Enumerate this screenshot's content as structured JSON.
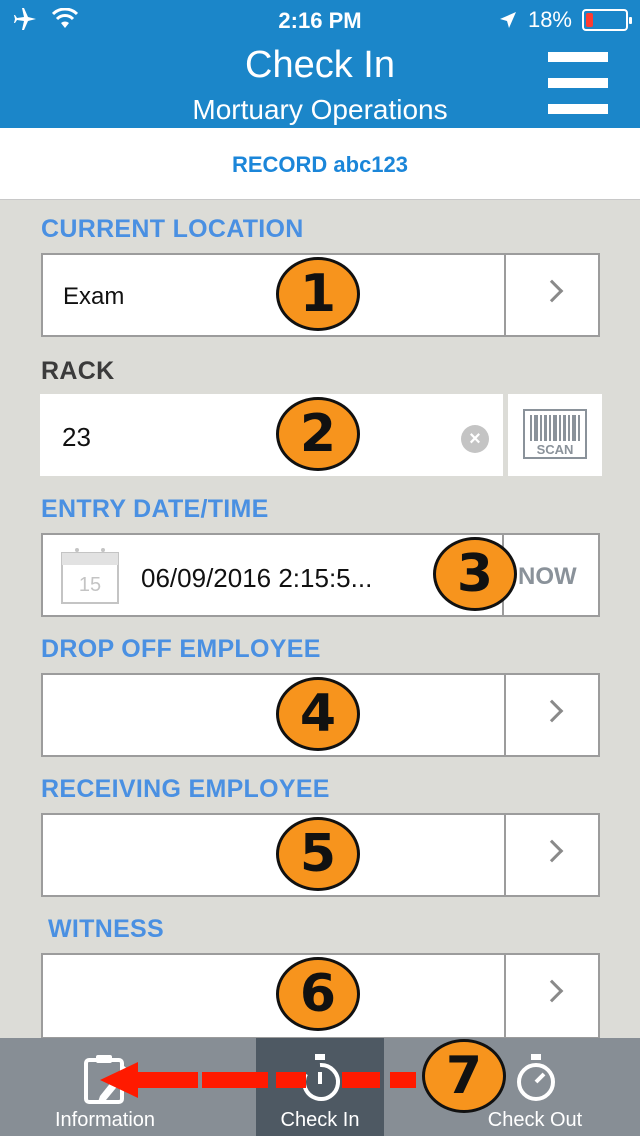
{
  "status_bar": {
    "time": "2:16 PM",
    "battery": "18%",
    "battery_level": 0.18
  },
  "header": {
    "title": "Check In",
    "subtitle": "Mortuary Operations"
  },
  "record": {
    "label": "RECORD abc123"
  },
  "fields": {
    "current_location": {
      "label": "CURRENT LOCATION",
      "value": "Exam"
    },
    "rack": {
      "label": "RACK",
      "value": "23",
      "scan_label": "SCAN"
    },
    "entry_datetime": {
      "label": "ENTRY DATE/TIME",
      "value": "06/09/2016 2:15:5...",
      "now_label": "NOW",
      "calendar_day": "15"
    },
    "drop_off_employee": {
      "label": "DROP OFF EMPLOYEE",
      "value": ""
    },
    "receiving_employee": {
      "label": "RECEIVING EMPLOYEE",
      "value": ""
    },
    "witness": {
      "label": "WITNESS",
      "value": ""
    }
  },
  "badges": [
    "1",
    "2",
    "3",
    "4",
    "5",
    "6",
    "7"
  ],
  "tabs": [
    {
      "label": "Information",
      "icon": "clipboard-pen-icon",
      "active": false
    },
    {
      "label": "Check In",
      "icon": "stopwatch-in-icon",
      "active": true
    },
    {
      "label": "Check Out",
      "icon": "stopwatch-icon",
      "active": false
    }
  ],
  "colors": {
    "header": "#1b86c9",
    "accent_label": "#4a90e2",
    "badge": "#f7941d",
    "arrow": "#ff1a00",
    "tabbar": "#878e95",
    "tab_active": "#4e5963"
  }
}
